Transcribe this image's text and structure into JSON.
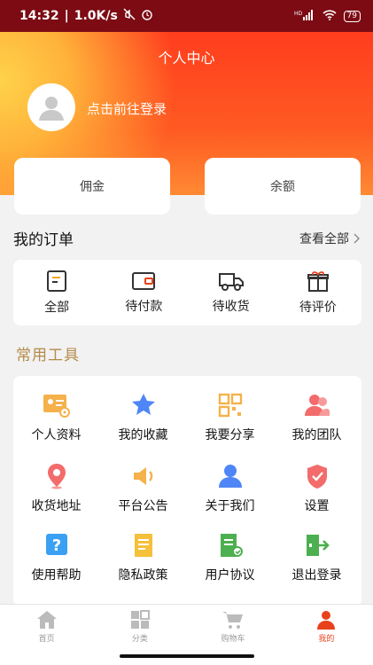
{
  "status": {
    "time": "14:32",
    "speed": "1.0K/s",
    "battery": "79",
    "signal": "HD"
  },
  "header": {
    "title": "个人中心",
    "login_text": "点击前往登录"
  },
  "stats": {
    "commission": "佣金",
    "balance": "余额"
  },
  "orders": {
    "title": "我的订单",
    "view_all": "查看全部",
    "items": [
      {
        "label": "全部",
        "icon": "list-icon"
      },
      {
        "label": "待付款",
        "icon": "wallet-icon"
      },
      {
        "label": "待收货",
        "icon": "truck-icon"
      },
      {
        "label": "待评价",
        "icon": "gift-icon"
      }
    ]
  },
  "tools": {
    "title": "常用工具",
    "items": [
      {
        "label": "个人资料",
        "icon": "profile-card-icon",
        "color": "#f5b14a"
      },
      {
        "label": "我的收藏",
        "icon": "star-icon",
        "color": "#4f86f7"
      },
      {
        "label": "我要分享",
        "icon": "qr-code-icon",
        "color": "#f5b14a"
      },
      {
        "label": "我的团队",
        "icon": "team-icon",
        "color": "#f36b6b"
      },
      {
        "label": "收货地址",
        "icon": "location-pin-icon",
        "color": "#f36b6b"
      },
      {
        "label": "平台公告",
        "icon": "speaker-icon",
        "color": "#f5b14a"
      },
      {
        "label": "关于我们",
        "icon": "user-icon",
        "color": "#4f86f7"
      },
      {
        "label": "设置",
        "icon": "shield-icon",
        "color": "#f36b6b"
      },
      {
        "label": "使用帮助",
        "icon": "help-icon",
        "color": "#3aa0f3"
      },
      {
        "label": "隐私政策",
        "icon": "document-icon",
        "color": "#f5c03a"
      },
      {
        "label": "用户协议",
        "icon": "agreement-icon",
        "color": "#4caf50"
      },
      {
        "label": "退出登录",
        "icon": "logout-icon",
        "color": "#4caf50"
      }
    ]
  },
  "tabbar": {
    "items": [
      {
        "label": "首页",
        "icon": "home-icon",
        "active": false
      },
      {
        "label": "分类",
        "icon": "grid-icon",
        "active": false
      },
      {
        "label": "购物车",
        "icon": "cart-icon",
        "active": false
      },
      {
        "label": "我的",
        "icon": "person-icon",
        "active": true
      }
    ]
  },
  "colors": {
    "accent": "#e8421c",
    "tools_title": "#b58b4a",
    "status_bg": "#7c0b14"
  }
}
